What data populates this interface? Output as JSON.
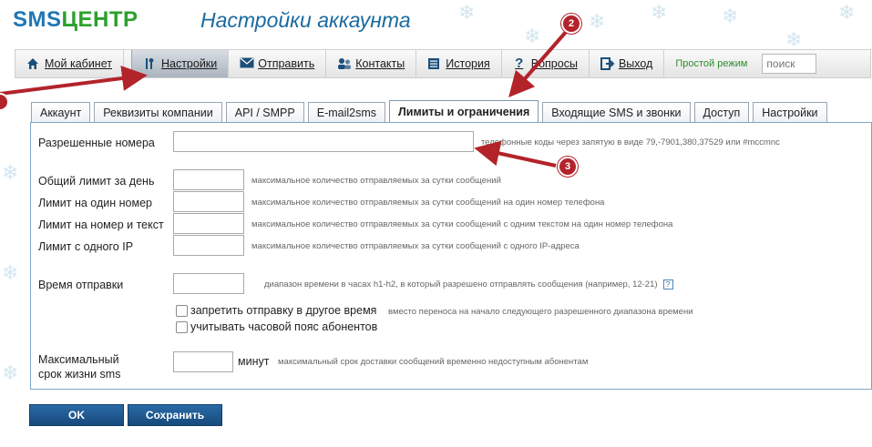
{
  "header": {
    "logo_sms": "SMS",
    "logo_centr": "ЦЕНТР",
    "title": "Настройки аккаунта"
  },
  "topnav": {
    "items": [
      {
        "label": "Мой кабинет",
        "icon": "home-icon"
      },
      {
        "label": "Настройки",
        "icon": "tools-icon",
        "active": true
      },
      {
        "label": "Отправить",
        "icon": "envelope-icon"
      },
      {
        "label": "Контакты",
        "icon": "users-icon"
      },
      {
        "label": "История",
        "icon": "list-icon"
      },
      {
        "label": "Вопросы",
        "icon": "question-icon"
      },
      {
        "label": "Выход",
        "icon": "exit-icon"
      }
    ],
    "simple_mode": "Простой режим",
    "search_placeholder": "поиск"
  },
  "tabs": [
    {
      "label": "Аккаунт"
    },
    {
      "label": "Реквизиты компании"
    },
    {
      "label": "API / SMPP"
    },
    {
      "label": "E-mail2sms"
    },
    {
      "label": "Лимиты и ограничения",
      "active": true
    },
    {
      "label": "Входящие SMS и звонки"
    },
    {
      "label": "Доступ"
    },
    {
      "label": "Настройки"
    }
  ],
  "form": {
    "allowed_numbers": {
      "label": "Разрешенные номера",
      "value": "",
      "hint": "телефонные коды через запятую в виде 79,-7901,380,37529 или #mccmnc"
    },
    "daily_limit": {
      "label": "Общий лимит за день",
      "value": "",
      "hint": "максимальное количество отправляемых за сутки сообщений"
    },
    "per_number_limit": {
      "label": "Лимит на один номер",
      "value": "",
      "hint": "максимальное количество отправляемых за сутки сообщений на один номер телефона"
    },
    "per_number_text_limit": {
      "label": "Лимит на номер и текст",
      "value": "",
      "hint": "максимальное количество отправляемых за сутки сообщений с одним текстом на один номер телефона"
    },
    "per_ip_limit": {
      "label": "Лимит с одного IP",
      "value": "",
      "hint": "максимальное количество отправляемых за сутки сообщений с одного IP-адреса"
    },
    "send_time": {
      "label": "Время отправки",
      "value": "",
      "hint": "диапазон времени в часах h1-h2, в который разрешено отправлять сообщения (например, 12-21)",
      "help": "?"
    },
    "forbid_other_time": {
      "label": "запретить отправку в другое время",
      "checked": false,
      "hint": "вместо переноса на начало следующего разрешенного диапазона времени"
    },
    "use_timezone": {
      "label": "учитывать часовой пояс абонентов",
      "checked": false
    },
    "max_lifetime": {
      "label_line1": "Максимальный",
      "label_line2": "срок жизни sms",
      "value": "",
      "unit": "минут",
      "hint": "максимальный срок доставки сообщений временно недоступным абонентам"
    }
  },
  "buttons": {
    "ok": "OK",
    "save": "Сохранить"
  },
  "annotations": {
    "badge2": "2",
    "badge3": "3",
    "color": "#b3232a"
  }
}
